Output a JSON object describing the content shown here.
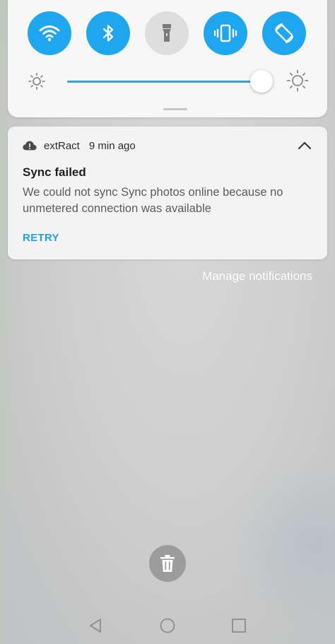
{
  "quick_settings": {
    "tiles": [
      {
        "name": "wifi",
        "icon": "wifi-icon",
        "state": "on"
      },
      {
        "name": "bluetooth",
        "icon": "bluetooth-icon",
        "state": "on"
      },
      {
        "name": "flashlight",
        "icon": "flashlight-icon",
        "state": "off"
      },
      {
        "name": "vibrate",
        "icon": "vibrate-icon",
        "state": "on"
      },
      {
        "name": "auto-rotate",
        "icon": "rotate-icon",
        "state": "on"
      }
    ],
    "brightness_level": 0.97,
    "accent_color": "#1ea7ef"
  },
  "notification": {
    "app_icon": "cloud-alert-icon",
    "app_name": "extRact",
    "time": "9 min ago",
    "title": "Sync failed",
    "body": "We could not sync Sync photos online because no unmetered connection was available",
    "action_label": "RETRY",
    "action_color": "#1fa0e6",
    "expand_icon": "chevron-up-icon"
  },
  "manage_label": "Manage notifications",
  "clear_all_icon": "trash-icon",
  "navbar": {
    "icons": [
      "back-icon",
      "home-icon",
      "recents-icon"
    ]
  }
}
